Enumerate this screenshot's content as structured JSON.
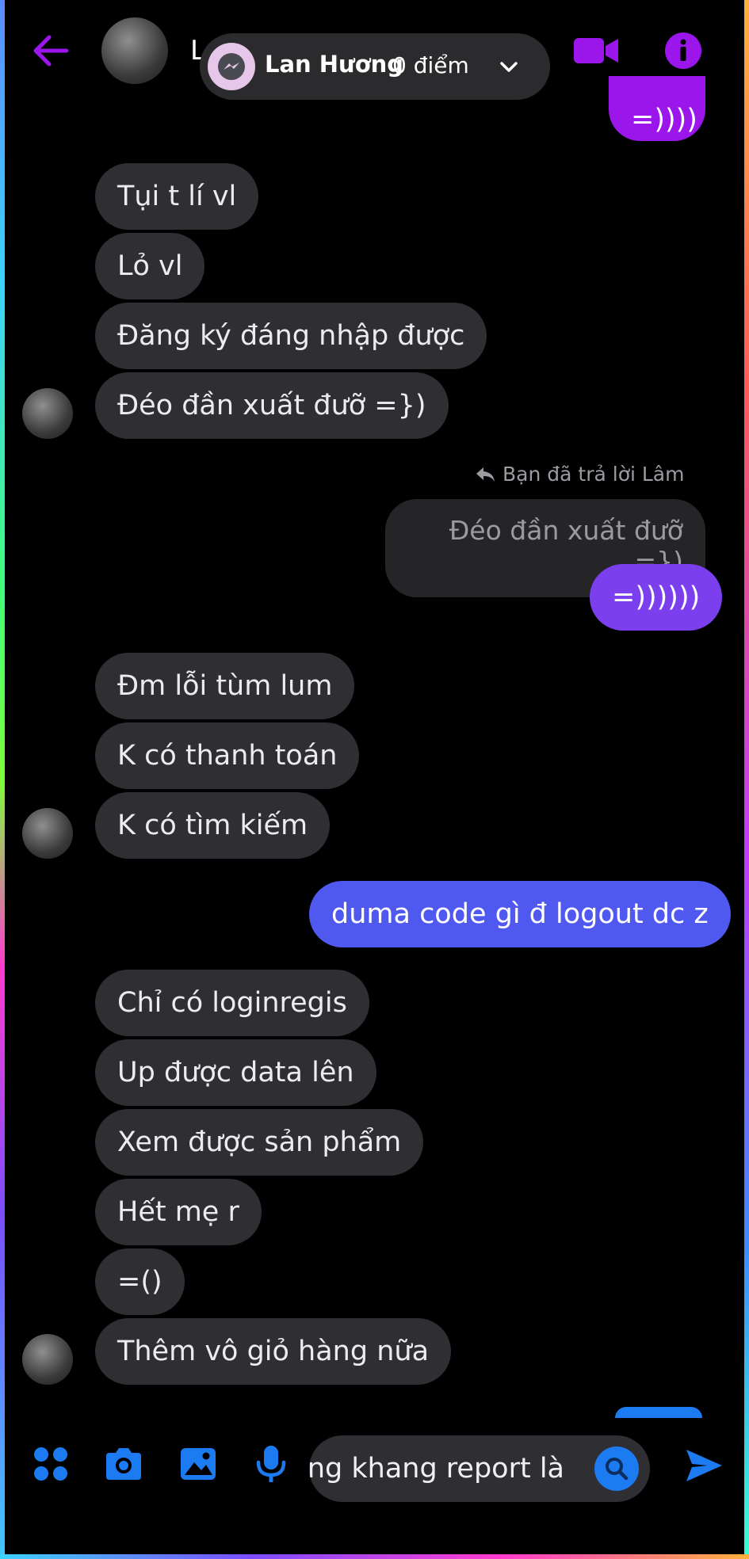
{
  "header": {
    "contact_initial": "L",
    "pill_name": "Lan Hương",
    "pill_score": "0 điểm"
  },
  "colors": {
    "accent": "#9b16ea",
    "blue": "#1d7bf2",
    "bubble_other": "#2f2f33"
  },
  "messages": {
    "m0": "=))))",
    "m1": "Tụi t lí vl",
    "m2": "Lỏ vl",
    "m3": "Đăng ký đáng nhập được",
    "m4": "Đéo đần xuất đưỡ =})",
    "reply_note": "Bạn đã trả lời Lâm",
    "quoted": "Đéo đần xuất đưỡ =})",
    "m5": "=))))))",
    "m6": "Đm lỗi tùm lum",
    "m7": "K có thanh toán",
    "m8": "K có tìm kiếm",
    "m9": "duma code gì đ logout dc z",
    "m10": "Chỉ có loginregis",
    "m11": "Up được data lên",
    "m12": "Xem được sản phẩm",
    "m13": "Hết mẹ r",
    "m14": "=()",
    "m15": "Thêm vô giỏ hàng nữa"
  },
  "composer": {
    "value": "ng khang report là"
  },
  "icons": [
    "back-icon",
    "messenger-icon",
    "chevron-down-icon",
    "video-call-icon",
    "info-icon",
    "reply-icon",
    "apps-icon",
    "camera-icon",
    "gallery-icon",
    "mic-icon",
    "search-icon",
    "send-icon"
  ]
}
